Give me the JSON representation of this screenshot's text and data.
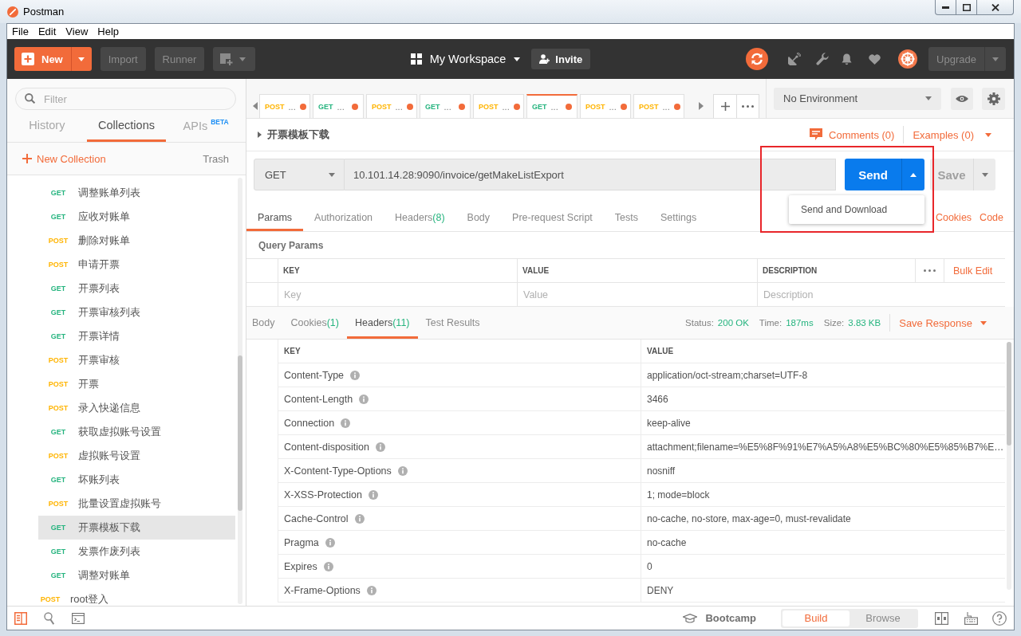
{
  "window": {
    "title": "Postman"
  },
  "menu_bar": [
    {
      "label": "File"
    },
    {
      "label": "Edit"
    },
    {
      "label": "View"
    },
    {
      "label": "Help"
    }
  ],
  "header": {
    "new_button": "New",
    "import_button": "Import",
    "runner_button": "Runner",
    "workspace": "My Workspace",
    "invite_button": "Invite",
    "upgrade_button": "Upgrade"
  },
  "sidebar": {
    "filter": {
      "placeholder": "Filter"
    },
    "tabs": [
      {
        "label": "History",
        "selected": false
      },
      {
        "label": "Collections",
        "selected": true
      },
      {
        "label": "APIs",
        "badge": "BETA",
        "selected": false
      }
    ],
    "new_collection": "New Collection",
    "trash": "Trash",
    "tree": [
      {
        "children": [
          {
            "method": "GET",
            "name": "调整账单列表",
            "color": "#26b47f",
            "selected": false
          },
          {
            "method": "GET",
            "name": "应收对账单",
            "color": "#26b47f",
            "selected": false
          },
          {
            "method": "POST",
            "name": "删除对账单",
            "color": "#ffb400",
            "selected": false
          },
          {
            "method": "POST",
            "name": "申请开票",
            "color": "#ffb400",
            "selected": false
          },
          {
            "method": "GET",
            "name": "开票列表",
            "color": "#26b47f",
            "selected": false
          },
          {
            "method": "GET",
            "name": "开票审核列表",
            "color": "#26b47f",
            "selected": false
          },
          {
            "method": "GET",
            "name": "开票详情",
            "color": "#26b47f",
            "selected": false
          },
          {
            "method": "POST",
            "name": "开票审核",
            "color": "#ffb400",
            "selected": false
          },
          {
            "method": "POST",
            "name": "开票",
            "color": "#ffb400",
            "selected": false
          },
          {
            "method": "POST",
            "name": "录入快递信息",
            "color": "#ffb400",
            "selected": false
          },
          {
            "method": "GET",
            "name": "获取虚拟账号设置",
            "color": "#26b47f",
            "selected": false
          },
          {
            "method": "POST",
            "name": "虚拟账号设置",
            "color": "#ffb400",
            "selected": false
          },
          {
            "method": "GET",
            "name": "坏账列表",
            "color": "#26b47f",
            "selected": false
          },
          {
            "method": "POST",
            "name": "批量设置虚拟账号",
            "color": "#ffb400",
            "selected": false
          },
          {
            "method": "GET",
            "name": "开票模板下载",
            "color": "#26b47f",
            "selected": true
          },
          {
            "method": "GET",
            "name": "发票作废列表",
            "color": "#26b47f",
            "selected": false
          },
          {
            "method": "GET",
            "name": "调整对账单",
            "color": "#26b47f",
            "selected": false
          }
        ]
      },
      {
        "method": "POST",
        "name": "root登入",
        "color": "#ffb400",
        "selected": false
      }
    ]
  },
  "request_tabs": [
    {
      "method": "POST",
      "label": "...",
      "color": "#ffb400",
      "unsaved": true,
      "selected": false
    },
    {
      "method": "GET",
      "label": "...",
      "color": "#26b47f",
      "unsaved": true,
      "selected": false
    },
    {
      "method": "POST",
      "label": "...",
      "color": "#ffb400",
      "unsaved": true,
      "selected": false
    },
    {
      "method": "GET",
      "label": "...",
      "color": "#26b47f",
      "unsaved": true,
      "selected": false
    },
    {
      "method": "POST",
      "label": "...",
      "color": "#ffb400",
      "unsaved": true,
      "selected": false
    },
    {
      "method": "GET",
      "label": "...",
      "color": "#26b47f",
      "unsaved": true,
      "selected": true
    },
    {
      "method": "POST",
      "label": "...",
      "color": "#ffb400",
      "unsaved": true,
      "selected": false
    },
    {
      "method": "POST",
      "label": "...",
      "color": "#ffb400",
      "unsaved": true,
      "selected": false
    }
  ],
  "environment": {
    "value": "No Environment"
  },
  "request": {
    "title": "开票模板下载",
    "comments": "Comments (0)",
    "examples": "Examples (0)",
    "method": "GET",
    "url": "10.101.14.28:9090/invoice/getMakeListExport",
    "send_button": "Send",
    "send_menu": [
      {
        "label": "Send and Download"
      }
    ],
    "save_button": "Save",
    "tabs": [
      {
        "label": "Params",
        "selected": true
      },
      {
        "label": "Authorization",
        "selected": false
      },
      {
        "label": "Headers",
        "count": "(8)",
        "selected": false
      },
      {
        "label": "Body",
        "selected": false
      },
      {
        "label": "Pre-request Script",
        "selected": false
      },
      {
        "label": "Tests",
        "selected": false
      },
      {
        "label": "Settings",
        "selected": false
      }
    ],
    "links": [
      {
        "label": "Cookies"
      },
      {
        "label": "Code"
      }
    ]
  },
  "query_params": {
    "title": "Query Params",
    "columns": [
      "KEY",
      "VALUE",
      "DESCRIPTION"
    ],
    "placeholders": [
      "Key",
      "Value",
      "Description"
    ],
    "bulk_edit": "Bulk Edit"
  },
  "response": {
    "tabs": [
      {
        "label": "Body",
        "selected": false
      },
      {
        "label": "Cookies",
        "count": "(1)",
        "selected": false
      },
      {
        "label": "Headers",
        "count": "(11)",
        "selected": true
      },
      {
        "label": "Test Results",
        "selected": false
      }
    ],
    "stats": [
      {
        "label": "Status:",
        "value": "200 OK"
      },
      {
        "label": "Time:",
        "value": "187ms"
      },
      {
        "label": "Size:",
        "value": "3.83 KB"
      }
    ],
    "save_button": "Save Response",
    "headers": {
      "columns": [
        "KEY",
        "VALUE"
      ],
      "rows": [
        {
          "key": "Content-Type",
          "value": "application/oct-stream;charset=UTF-8"
        },
        {
          "key": "Content-Length",
          "value": "3466"
        },
        {
          "key": "Connection",
          "value": "keep-alive"
        },
        {
          "key": "Content-disposition",
          "value": "attachment;filename=%E5%8F%91%E7%A5%A8%E5%BC%80%E5%85%B7%E…"
        },
        {
          "key": "X-Content-Type-Options",
          "value": "nosniff"
        },
        {
          "key": "X-XSS-Protection",
          "value": "1; mode=block"
        },
        {
          "key": "Cache-Control",
          "value": "no-cache, no-store, max-age=0, must-revalidate"
        },
        {
          "key": "Pragma",
          "value": "no-cache"
        },
        {
          "key": "Expires",
          "value": "0"
        },
        {
          "key": "X-Frame-Options",
          "value": "DENY"
        }
      ]
    }
  },
  "status_bar": {
    "bootcamp": "Bootcamp",
    "modes": [
      {
        "label": "Build",
        "selected": true
      },
      {
        "label": "Browse",
        "selected": false
      }
    ]
  }
}
